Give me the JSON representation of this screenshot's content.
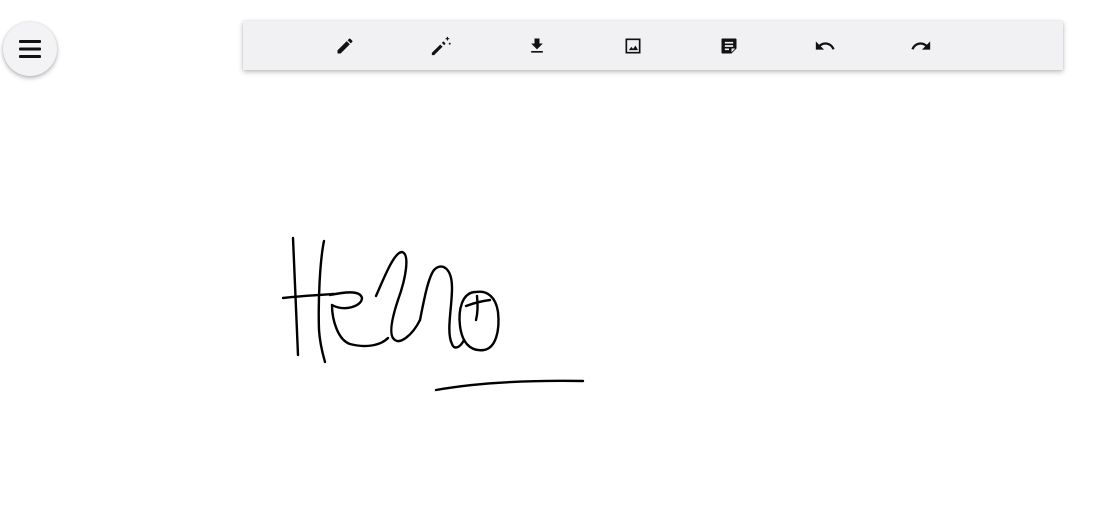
{
  "menu_button": {
    "icon": "hamburger-menu-icon"
  },
  "toolbar": {
    "tools": [
      {
        "icon": "pencil-icon"
      },
      {
        "icon": "magic-pen-icon"
      },
      {
        "icon": "download-icon"
      },
      {
        "icon": "image-icon"
      },
      {
        "icon": "sticky-note-icon"
      },
      {
        "icon": "undo-icon"
      },
      {
        "icon": "redo-icon"
      }
    ]
  },
  "canvas": {
    "ink_color": "#000000",
    "background": "#ffffff"
  },
  "colors": {
    "toolbar_bg": "#f1f1f4",
    "icon": "#111111"
  }
}
